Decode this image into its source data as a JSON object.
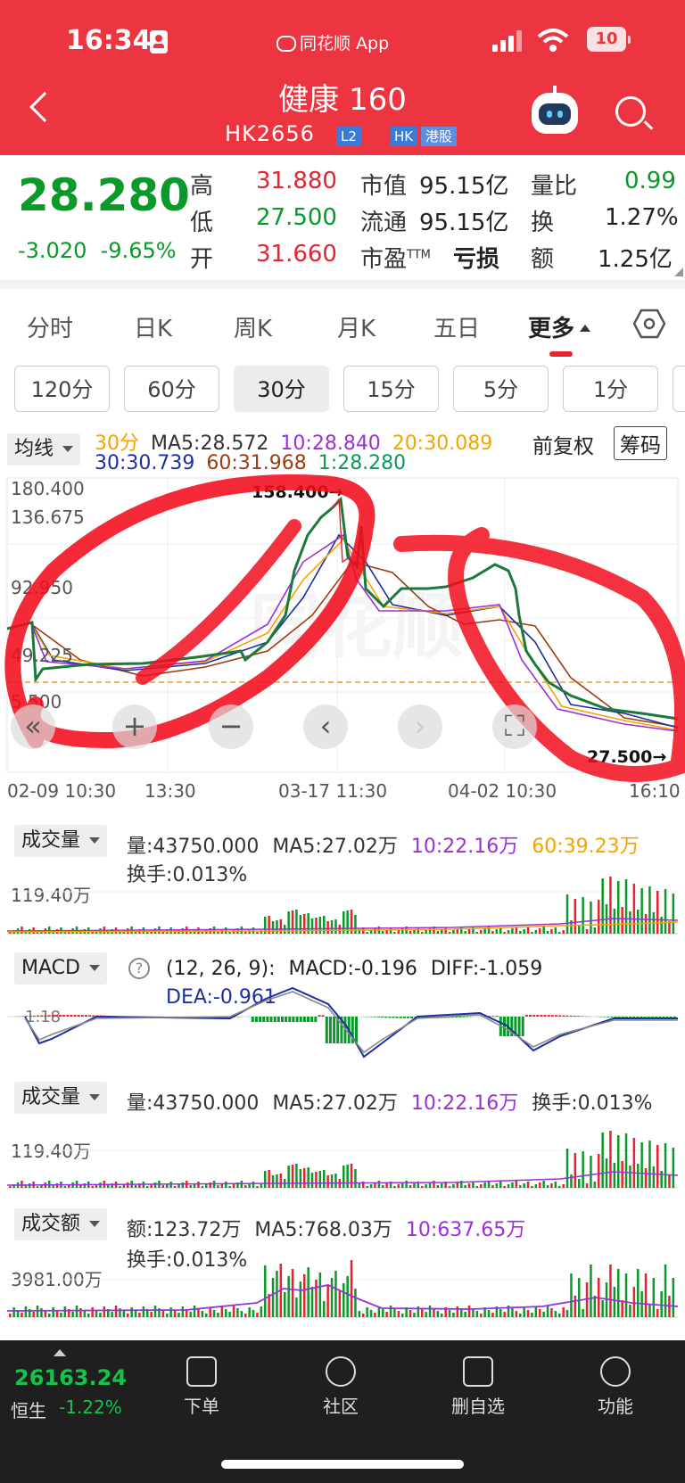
{
  "status_bar": {
    "time": "16:34",
    "source_app": "同花顺 App",
    "battery": "10"
  },
  "header": {
    "title": "健康 160",
    "code": "HK2656",
    "badge_l2": "L2",
    "badge_hk": "HK",
    "badge_market": "港股"
  },
  "quote": {
    "price": "28.280",
    "change": "-3.020",
    "change_pct": "-9.65%",
    "high_label": "高",
    "high": "31.880",
    "low_label": "低",
    "low": "27.500",
    "open_label": "开",
    "open": "31.660",
    "mcap_label": "市值",
    "mcap": "95.15亿",
    "float_label": "流通",
    "float": "95.15亿",
    "pe_label": "市盈",
    "pe_sup": "TTM",
    "pe": "亏损",
    "vol_ratio_label": "量比",
    "vol_ratio": "0.99",
    "turnover_label": "换",
    "turnover": "1.27%",
    "amount_label": "额",
    "amount": "1.25亿"
  },
  "tabs": [
    "分时",
    "日K",
    "周K",
    "月K",
    "五日",
    "更多"
  ],
  "periods": [
    "120分",
    "60分",
    "30分",
    "15分",
    "5分",
    "1分"
  ],
  "ma_bar": {
    "selector": "均线",
    "period": "30分",
    "ma5": "MA5:28.572",
    "ma10": "10:28.840",
    "ma20": "20:30.089",
    "ma30": "30:30.739",
    "ma60": "60:31.968",
    "ma1": "1:28.280",
    "adjust": "前复权",
    "chips": "筹码"
  },
  "price_chart": {
    "y_ticks": [
      "180.400",
      "136.675",
      "92.950",
      "49.225",
      "5.500"
    ],
    "x_ticks": [
      "02-09 10:30",
      "13:30",
      "03-17 11:30",
      "04-02 10:30",
      "16:10"
    ],
    "high_marker": "158.400→",
    "low_marker": "27.500→",
    "watermark": "同花顺"
  },
  "vol_panel_1": {
    "selector": "成交量",
    "vol": "量:43750.000",
    "ma5": "MA5:27.02万",
    "ma10": "10:22.16万",
    "ma60": "60:39.23万",
    "turnover": "换手:0.013%",
    "ymax": "119.40万"
  },
  "macd_panel": {
    "selector": "MACD",
    "help": "?",
    "params": "(12, 26, 9):",
    "macd": "MACD:-0.196",
    "diff": "DIFF:-1.059",
    "dea": "DEA:-0.961",
    "ymax": "1.18"
  },
  "vol_panel_2": {
    "selector": "成交量",
    "vol": "量:43750.000",
    "ma5": "MA5:27.02万",
    "ma10": "10:22.16万",
    "turnover": "换手:0.013%",
    "ymax": "119.40万"
  },
  "amount_panel": {
    "selector": "成交额",
    "amt": "额:123.72万",
    "ma5": "MA5:768.03万",
    "ma10": "10:637.65万",
    "turnover": "换手:0.013%",
    "ymax": "3981.00万"
  },
  "footer": {
    "index_value": "26163.24",
    "index_name": "恒生",
    "index_change": "-1.22%",
    "items": [
      "下单",
      "社区",
      "删自选",
      "功能"
    ]
  },
  "colors": {
    "brand_red": "#ec3541",
    "up": "#e8222f",
    "down": "#0a9a2a",
    "ma10": "#9b30d9",
    "ma20": "#f5a300",
    "ma30": "#1c2fa0",
    "ma60": "#a03a10"
  }
}
